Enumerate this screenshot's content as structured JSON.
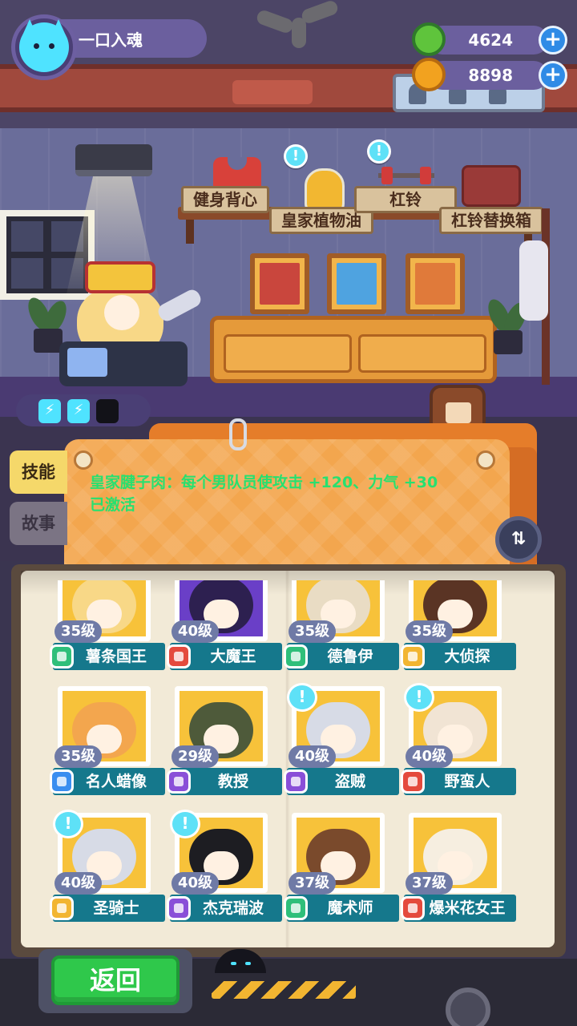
{
  "player": {
    "name": "一口入魂",
    "avatar": "cat-avatar-icon"
  },
  "currencies": [
    {
      "name": "green-coin-icon",
      "value": "4624",
      "color": "#5fc43c"
    },
    {
      "name": "gold-coin-icon",
      "value": "8898",
      "color": "#f2a21f"
    }
  ],
  "room_items": [
    {
      "label": "健身背心"
    },
    {
      "label": "皇家植物油"
    },
    {
      "label": "杠铃"
    },
    {
      "label": "杠铃替换箱"
    }
  ],
  "energy": {
    "filled": 2,
    "total": 3
  },
  "tabs": [
    {
      "label": "技能",
      "active": true
    },
    {
      "label": "故事",
      "active": false
    }
  ],
  "skill": {
    "line1": "皇家腱子肉：每个男队员使攻击 +120、力气 +30",
    "line2": "已激活"
  },
  "characters": [
    {
      "level": "35级",
      "name": "薯条国王",
      "badge_color": "#2fbf7a",
      "art_color": "#f7c23a",
      "hair": "#f8d887",
      "alert": false
    },
    {
      "level": "40级",
      "name": "大魔王",
      "badge_color": "#e44a3d",
      "art_color": "#6a3fc7",
      "hair": "#2d2050",
      "alert": false
    },
    {
      "level": "35级",
      "name": "德鲁伊",
      "badge_color": "#2fbf7a",
      "art_color": "#f7c23a",
      "hair": "#e9dcc4",
      "alert": false
    },
    {
      "level": "35级",
      "name": "大侦探",
      "badge_color": "#f2b531",
      "art_color": "#f7c23a",
      "hair": "#5a3424",
      "alert": false
    },
    {
      "level": "35级",
      "name": "名人蜡像",
      "badge_color": "#3a8ef0",
      "art_color": "#f7c23a",
      "hair": "#f3a64e",
      "alert": false
    },
    {
      "level": "29级",
      "name": "教授",
      "badge_color": "#8a4fd8",
      "art_color": "#f7c23a",
      "hair": "#4e5a3a",
      "alert": false
    },
    {
      "level": "40级",
      "name": "盗贼",
      "badge_color": "#8a4fd8",
      "art_color": "#f7c23a",
      "hair": "#d7dbe6",
      "alert": true
    },
    {
      "level": "40级",
      "name": "野蛮人",
      "badge_color": "#e44a3d",
      "art_color": "#f7c23a",
      "hair": "#f1e4d4",
      "alert": true
    },
    {
      "level": "40级",
      "name": "圣骑士",
      "badge_color": "#f2b531",
      "art_color": "#f7c23a",
      "hair": "#d7dbe6",
      "alert": true
    },
    {
      "level": "40级",
      "name": "杰克瑞波",
      "badge_color": "#8a4fd8",
      "art_color": "#f7c23a",
      "hair": "#1d1d22",
      "alert": true
    },
    {
      "level": "37级",
      "name": "魔术师",
      "badge_color": "#2fbf7a",
      "art_color": "#f7c23a",
      "hair": "#7a4a2c",
      "alert": false
    },
    {
      "level": "37级",
      "name": "爆米花女王",
      "badge_color": "#e44a3d",
      "art_color": "#f7c23a",
      "hair": "#f6eee0",
      "alert": false
    }
  ],
  "back_button": {
    "label": "返回"
  },
  "icons": {
    "plus": "+",
    "alert": "!",
    "energy": "⚡",
    "swap": "⇅"
  }
}
